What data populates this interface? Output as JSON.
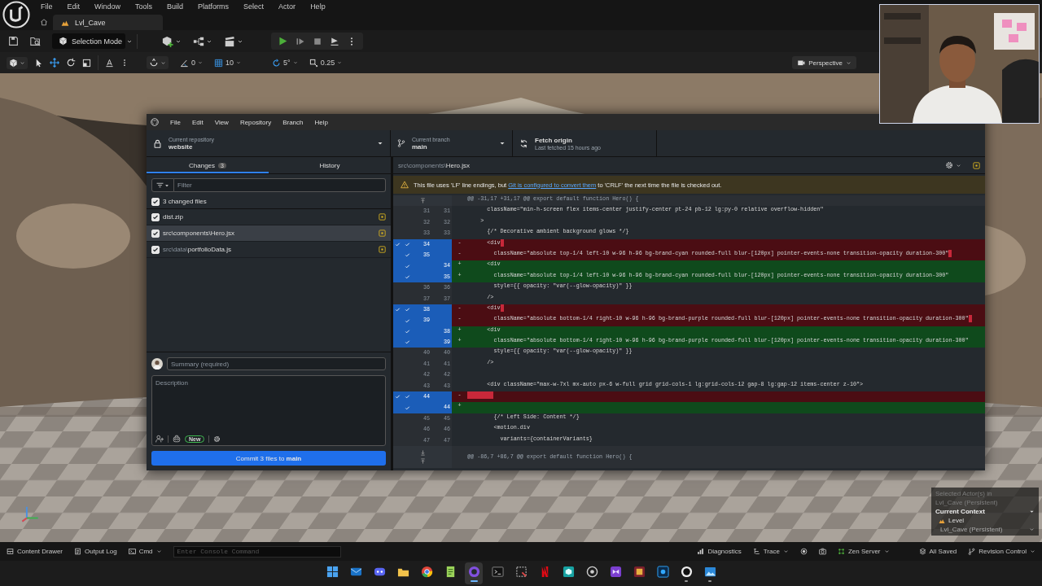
{
  "editor": {
    "menu": [
      "File",
      "Edit",
      "Window",
      "Tools",
      "Build",
      "Platforms",
      "Select",
      "Actor",
      "Help"
    ],
    "level_tab": "Lvl_Cave",
    "mode": "Selection Mode",
    "snaps": [
      "0",
      "10",
      "5°",
      "0.25"
    ],
    "view_mode": "Perspective"
  },
  "github": {
    "menu": [
      "File",
      "Edit",
      "View",
      "Repository",
      "Branch",
      "Help"
    ],
    "repository": {
      "label": "Current repository",
      "value": "website"
    },
    "branch": {
      "label": "Current branch",
      "value": "main"
    },
    "fetch": {
      "label": "Fetch origin",
      "detail": "Last fetched 15 hours ago"
    },
    "tabs": [
      {
        "label": "Changes",
        "count": "3",
        "selected": true
      },
      {
        "label": "History",
        "selected": false
      }
    ],
    "filter": {
      "placeholder": "Filter"
    },
    "select_all": {
      "label": "3 changed files",
      "checked": true
    },
    "files": [
      {
        "name": "dist.zip",
        "checked": true,
        "selected": false
      },
      {
        "folder": "src\\components\\",
        "name": "Hero.jsx",
        "checked": true,
        "selected": true
      },
      {
        "folder": "src\\data\\",
        "name": "portfolioData.js",
        "checked": true,
        "selected": false
      }
    ],
    "summary": {
      "placeholder": "Summary (required)"
    },
    "description": {
      "placeholder": "Description"
    },
    "new_badge": "New",
    "commit_button": "Commit 3 files to **main**",
    "diff": {
      "path": {
        "folder": "src\\components\\",
        "name": "Hero.jsx"
      },
      "warning": {
        "before": "This file uses 'LF' line endings, but ",
        "link": "Git is configured to convert them",
        "after": " to 'CRLF' the next time the file is checked out."
      },
      "lines": [
        {
          "kind": "hunk",
          "text": "@@ -31,17 +31,17 @@ export default function Hero() {"
        },
        {
          "kind": "context",
          "old": "31",
          "new": "31",
          "text": "      className=\"min-h-screen flex items-center justify-center pt-24 pb-12 lg:py-0 relative overflow-hidden\""
        },
        {
          "kind": "context",
          "old": "32",
          "new": "32",
          "text": "    >"
        },
        {
          "kind": "context",
          "old": "33",
          "new": "33",
          "text": "      {/* Decorative ambient background glows */}"
        },
        {
          "kind": "removed",
          "old": "34",
          "sign": "-",
          "text": "      <div",
          "included": true,
          "trailing_whitespace": true
        },
        {
          "kind": "removed",
          "old": "35",
          "sign": "-",
          "text": "        className=\"absolute top-1/4 left-10 w-96 h-96 bg-brand-cyan rounded-full blur-[120px] pointer-events-none transition-opacity duration-300\"",
          "included": true,
          "trailing_whitespace": true
        },
        {
          "kind": "added",
          "new": "34",
          "sign": "+",
          "text": "      <div",
          "included": true
        },
        {
          "kind": "added",
          "new": "35",
          "sign": "+",
          "text": "        className=\"absolute top-1/4 left-10 w-96 h-96 bg-brand-cyan rounded-full blur-[120px] pointer-events-none transition-opacity duration-300\"",
          "included": true
        },
        {
          "kind": "context",
          "old": "36",
          "new": "36",
          "text": "        style={{ opacity: \"var(--glow-opacity)\" }}"
        },
        {
          "kind": "context",
          "old": "37",
          "new": "37",
          "text": "      />"
        },
        {
          "kind": "removed",
          "old": "38",
          "sign": "-",
          "text": "      <div",
          "included": true,
          "trailing_whitespace": true
        },
        {
          "kind": "removed",
          "old": "39",
          "sign": "-",
          "text": "        className=\"absolute bottom-1/4 right-10 w-96 h-96 bg-brand-purple rounded-full blur-[120px] pointer-events-none transition-opacity duration-300\"",
          "included": true,
          "trailing_whitespace": true
        },
        {
          "kind": "added",
          "new": "38",
          "sign": "+",
          "text": "      <div",
          "included": true
        },
        {
          "kind": "added",
          "new": "39",
          "sign": "+",
          "text": "        className=\"absolute bottom-1/4 right-10 w-96 h-96 bg-brand-purple rounded-full blur-[120px] pointer-events-none transition-opacity duration-300\"",
          "included": true
        },
        {
          "kind": "context",
          "old": "40",
          "new": "40",
          "text": "        style={{ opacity: \"var(--glow-opacity)\" }}"
        },
        {
          "kind": "context",
          "old": "41",
          "new": "41",
          "text": "      />"
        },
        {
          "kind": "context",
          "old": "42",
          "new": "42"
        },
        {
          "kind": "context",
          "old": "43",
          "new": "43",
          "text": "      <div className=\"max-w-7xl mx-auto px-6 w-full grid grid-cols-1 lg:grid-cols-12 gap-8 lg:gap-12 items-center z-10\">"
        },
        {
          "kind": "removed",
          "old": "44",
          "sign": "-",
          "included": true,
          "trailing_whitespace": true
        },
        {
          "kind": "added",
          "new": "44",
          "sign": "+",
          "included": true
        },
        {
          "kind": "context",
          "old": "45",
          "new": "45",
          "text": "        {/* Left Side: Content */}"
        },
        {
          "kind": "context",
          "old": "46",
          "new": "46",
          "text": "        <motion.div"
        },
        {
          "kind": "context",
          "old": "47",
          "new": "47",
          "text": "          variants={containerVariants}"
        },
        {
          "kind": "hunk",
          "text": "@@ -86,7 +86,7 @@ export default function Hero() {"
        }
      ]
    }
  },
  "outliner": {
    "caption": [
      "Selected Actor(s) in",
      "Lvl_Cave (Persistent)"
    ],
    "context": "Current Context",
    "level_label": "Level",
    "level_value": "Lvl_Cave (Persistent)"
  },
  "status_bar": {
    "content_drawer": "Content Drawer",
    "output_log": "Output Log",
    "cmd": "Cmd",
    "console_placeholder": "Enter Console Command",
    "diagnostics": "Diagnostics",
    "trace": "Trace",
    "zen_server": "Zen Server",
    "save_state": "All Saved",
    "revision_control": "Revision Control"
  },
  "taskbar": {
    "apps": [
      {
        "running": false,
        "selected": false
      },
      {
        "running": false,
        "selected": false
      },
      {
        "running": false,
        "selected": false
      },
      {
        "running": false,
        "selected": false
      },
      {
        "running": false,
        "selected": false
      },
      {
        "running": false,
        "selected": false
      },
      {
        "running": true,
        "selected": true
      },
      {
        "running": false,
        "selected": false
      },
      {
        "running": false,
        "selected": false
      },
      {
        "running": false,
        "selected": false
      },
      {
        "running": false,
        "selected": false
      },
      {
        "running": false,
        "selected": false
      },
      {
        "running": false,
        "selected": false
      },
      {
        "running": false,
        "selected": false
      },
      {
        "running": false,
        "selected": false
      },
      {
        "running": true,
        "selected": false
      },
      {
        "running": true,
        "selected": false
      }
    ]
  }
}
